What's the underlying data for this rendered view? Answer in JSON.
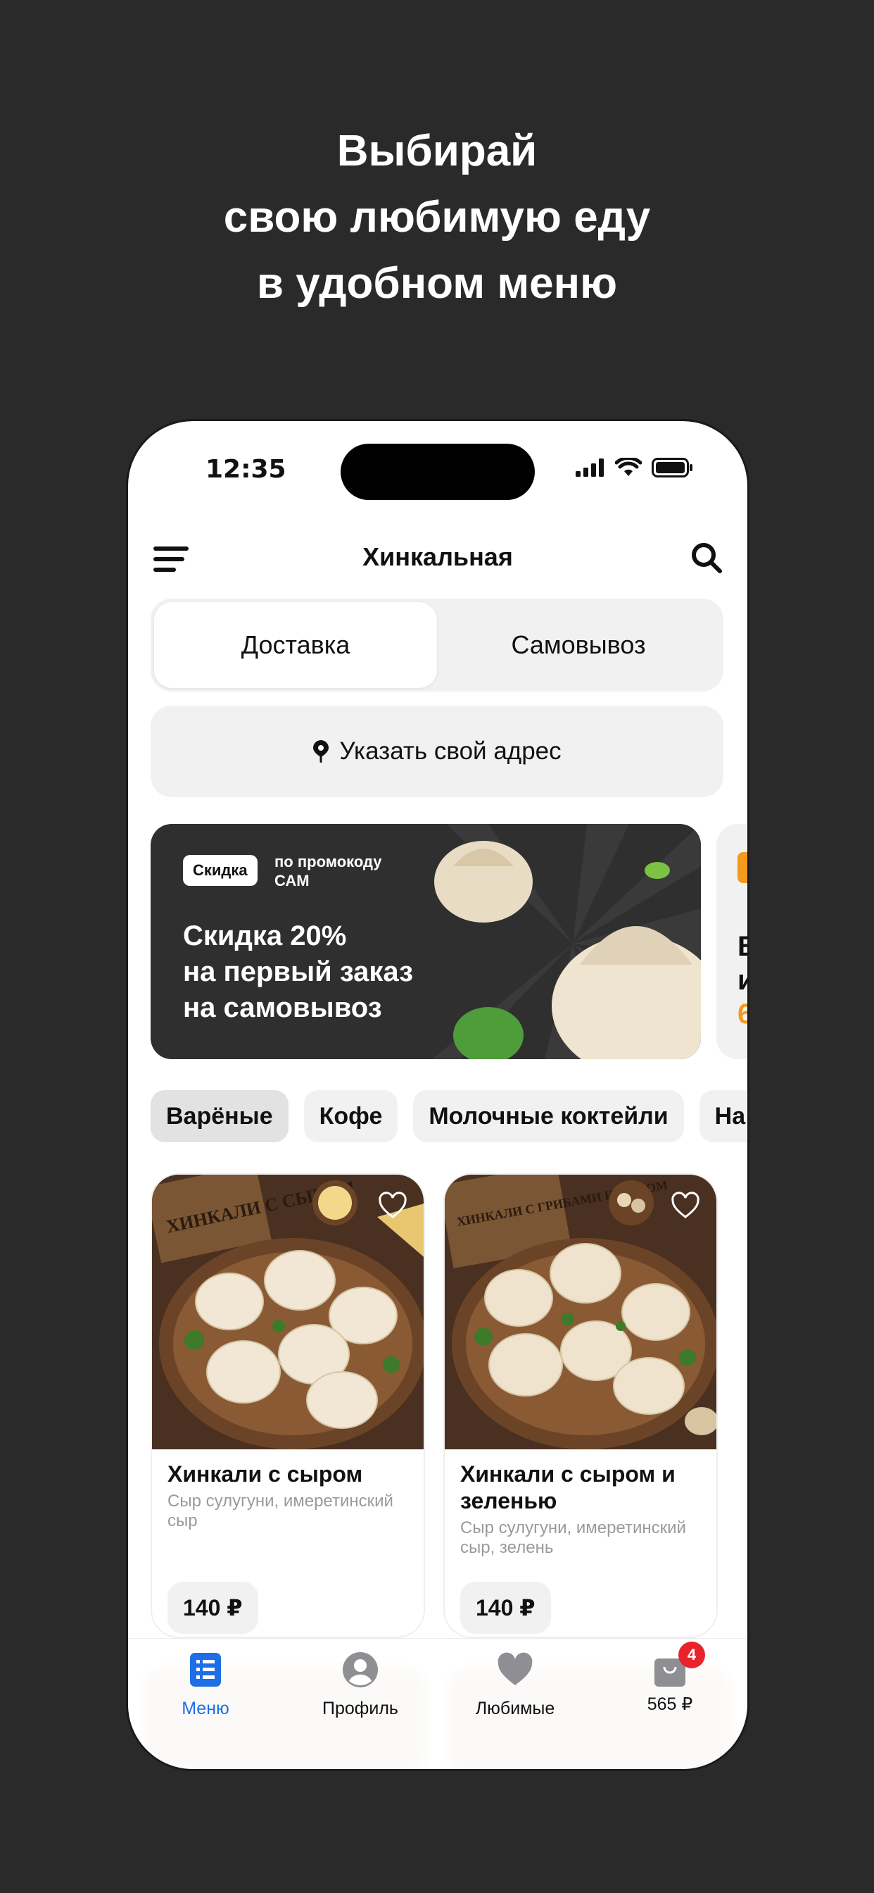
{
  "headline": {
    "line1": "Выбирай",
    "line2": "свою любимую еду",
    "line3": "в удобном меню"
  },
  "status_bar": {
    "time": "12:35"
  },
  "header": {
    "title": "Хинкальная"
  },
  "delivery_toggle": {
    "options": [
      "Доставка",
      "Самовывоз"
    ],
    "selected": "Доставка"
  },
  "address": {
    "label": "Указать свой адрес"
  },
  "promo": {
    "tag": "Скидка",
    "tag_note": "по промокоду САМ",
    "title": "Скидка 20%\nна первый заказ\nна самовывоз"
  },
  "next_banner_partial": {
    "line1": "В",
    "line2": "и",
    "line3": "6"
  },
  "categories": [
    "Варёные",
    "Кофе",
    "Молочные коктейли",
    "На"
  ],
  "active_category": "Варёные",
  "products": [
    {
      "title": "Хинкали с сыром",
      "description": "Сыр сулугуни, имеретинский сыр",
      "price": "140 ₽",
      "image_caption": "ХИНКАЛИ С СЫРОМ"
    },
    {
      "title": "Хинкали с сыром и зеленью",
      "description": "Сыр сулугуни, имеретинский сыр, зелень",
      "price": "140 ₽",
      "image_caption": "ХИНКАЛИ С ГРИБАМИ И СЫРОМ"
    }
  ],
  "tabbar": {
    "items": [
      {
        "label": "Меню",
        "icon": "menu-list-icon"
      },
      {
        "label": "Профиль",
        "icon": "profile-icon"
      },
      {
        "label": "Любимые",
        "icon": "heart-icon"
      },
      {
        "label": "565 ₽",
        "icon": "cart-icon"
      }
    ],
    "cart_count": "4"
  },
  "colors": {
    "accent": "#1e6fe6",
    "badge": "#e8232b",
    "promo_orange": "#f39a1c"
  }
}
